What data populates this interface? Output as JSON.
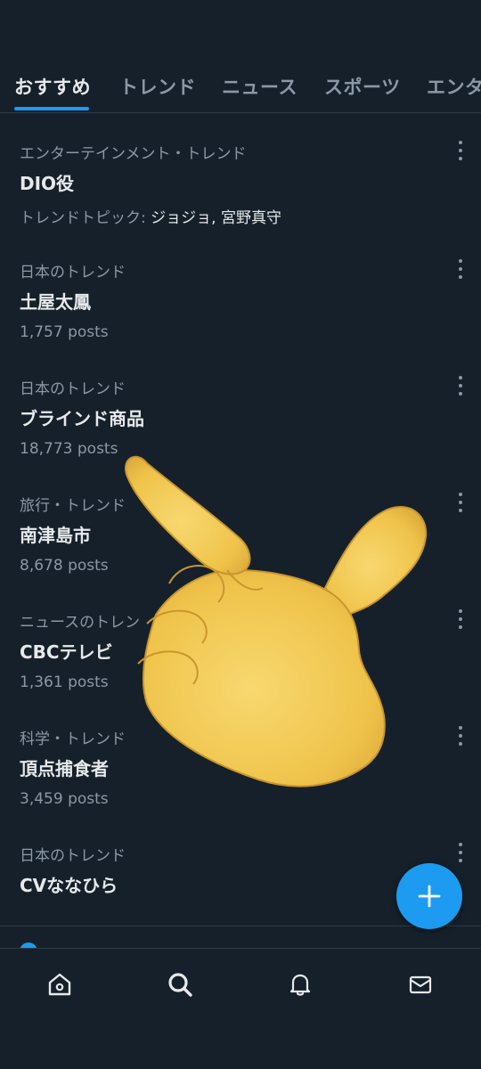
{
  "tabs": [
    {
      "label": "おすすめ",
      "active": true
    },
    {
      "label": "トレンド",
      "active": false
    },
    {
      "label": "ニュース",
      "active": false
    },
    {
      "label": "スポーツ",
      "active": false
    },
    {
      "label": "エンタ",
      "active": false
    }
  ],
  "trends": [
    {
      "category": "エンターテインメント・トレンド",
      "name": "DIO役",
      "topic_prefix": "トレンドトピック: ",
      "topic_value": "ジョジョ, 宮野真守"
    },
    {
      "category": "日本のトレンド",
      "name": "土屋太鳳",
      "posts": "1,757 posts"
    },
    {
      "category": "日本のトレンド",
      "name": "ブラインド商品",
      "posts": "18,773 posts"
    },
    {
      "category": "旅行・トレンド",
      "name": "南津島市",
      "posts": "8,678 posts"
    },
    {
      "category": "ニュースのトレン",
      "name": "CBCテレビ",
      "posts": "1,361 posts"
    },
    {
      "category": "科学・トレンド",
      "name": "頂点捕食者",
      "posts": "3,459 posts"
    },
    {
      "category": "日本のトレンド",
      "name": "CVななひら"
    }
  ],
  "icons": {
    "more": "more-vertical-icon",
    "fab": "plus-icon",
    "nav": [
      "home-icon",
      "search-icon",
      "bell-icon",
      "mail-icon"
    ],
    "overlay": "backhand-index-pointing-left-emoji"
  },
  "colors": {
    "background": "#15202b",
    "accent": "#1d9bf0",
    "text_primary": "#e7e9ea",
    "text_secondary": "#8b98a5",
    "hand": "#f2c94c"
  }
}
